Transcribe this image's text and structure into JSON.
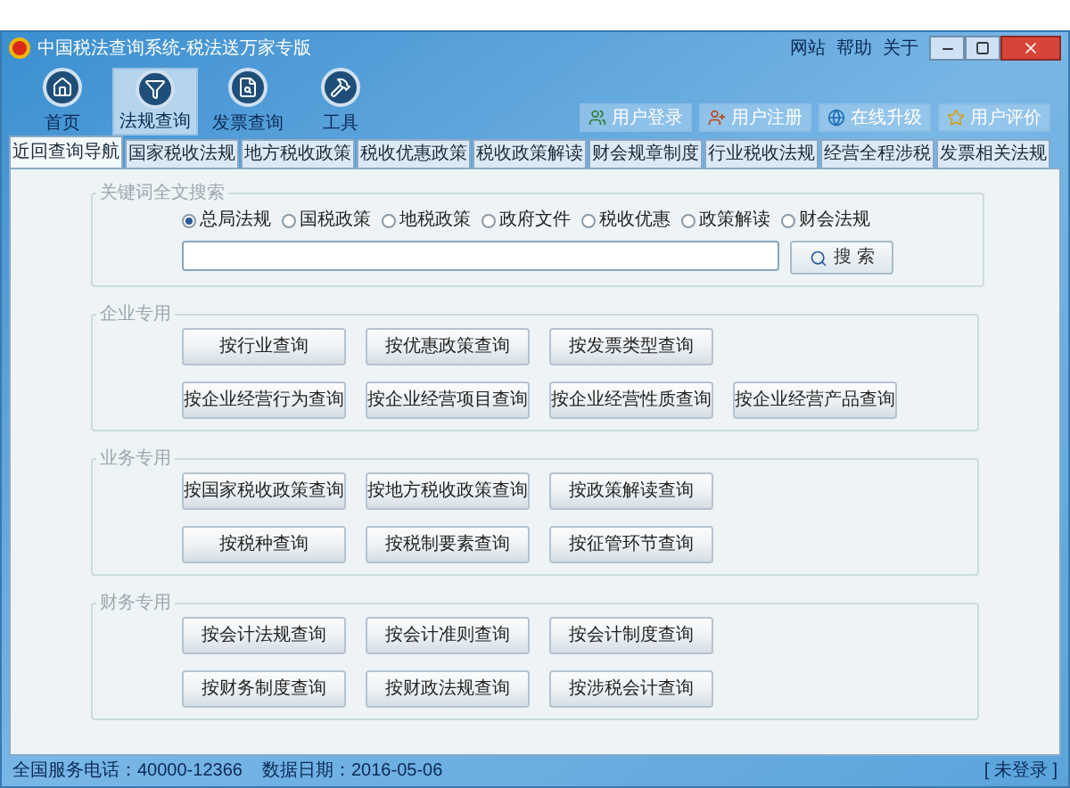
{
  "window": {
    "title": "中国税法查询系统-税法送万家专版"
  },
  "top_links": [
    "网站",
    "帮助",
    "关于"
  ],
  "nav_items": [
    {
      "label": "首页",
      "selected": false
    },
    {
      "label": "法规查询",
      "selected": true
    },
    {
      "label": "发票查询",
      "selected": false
    },
    {
      "label": "工具",
      "selected": false
    }
  ],
  "user_buttons": [
    "用户登录",
    "用户注册",
    "在线升级",
    "用户评价"
  ],
  "tabs": [
    {
      "label": "近回查询导航",
      "selected": true
    },
    {
      "label": "国家税收法规",
      "selected": false
    },
    {
      "label": "地方税收政策",
      "selected": false
    },
    {
      "label": "税收优惠政策",
      "selected": false
    },
    {
      "label": "税收政策解读",
      "selected": false
    },
    {
      "label": "财会规章制度",
      "selected": false
    },
    {
      "label": "行业税收法规",
      "selected": false
    },
    {
      "label": "经营全程涉税",
      "selected": false
    },
    {
      "label": "发票相关法规",
      "selected": false
    }
  ],
  "search": {
    "legend": "关键词全文搜索",
    "button": "搜 索",
    "options": [
      {
        "label": "总局法规",
        "selected": true
      },
      {
        "label": "国税政策",
        "selected": false
      },
      {
        "label": "地税政策",
        "selected": false
      },
      {
        "label": "政府文件",
        "selected": false
      },
      {
        "label": "税收优惠",
        "selected": false
      },
      {
        "label": "政策解读",
        "selected": false
      },
      {
        "label": "财会法规",
        "selected": false
      }
    ]
  },
  "sections": [
    {
      "title": "企业专用",
      "rows": [
        [
          "按行业查询",
          "按优惠政策查询",
          "按发票类型查询"
        ],
        [
          "按企业经营行为查询",
          "按企业经营项目查询",
          "按企业经营性质查询",
          "按企业经营产品查询"
        ]
      ]
    },
    {
      "title": "业务专用",
      "rows": [
        [
          "按国家税收政策查询",
          "按地方税收政策查询",
          "按政策解读查询"
        ],
        [
          "按税种查询",
          "按税制要素查询",
          "按征管环节查询"
        ]
      ]
    },
    {
      "title": "财务专用",
      "rows": [
        [
          "按会计法规查询",
          "按会计准则查询",
          "按会计制度查询"
        ],
        [
          "按财务制度查询",
          "按财政法规查询",
          "按涉税会计查询"
        ]
      ]
    }
  ],
  "status_bar": {
    "phone": "全国服务电话：40000-12366",
    "date": "数据日期：2016-05-06",
    "login": "[ 未登录 ]"
  }
}
